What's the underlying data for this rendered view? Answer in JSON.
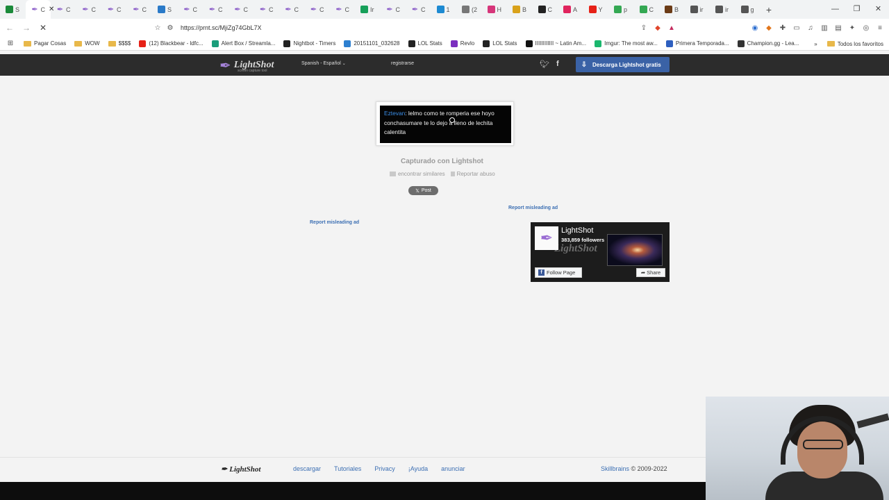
{
  "browser": {
    "tabs": [
      {
        "label": "S",
        "icon": "k-icon",
        "color": "#1b8a3a"
      },
      {
        "label": "C",
        "icon": "lightshot-feather-icon",
        "active": true
      },
      {
        "label": "C",
        "icon": "lightshot-feather-icon"
      },
      {
        "label": "C",
        "icon": "lightshot-feather-icon"
      },
      {
        "label": "C",
        "icon": "lightshot-feather-icon"
      },
      {
        "label": "C",
        "icon": "lightshot-feather-icon"
      },
      {
        "label": "S",
        "icon": "chart-icon",
        "color": "#2a7ac8"
      },
      {
        "label": "C",
        "icon": "lightshot-feather-icon"
      },
      {
        "label": "C",
        "icon": "lightshot-feather-icon"
      },
      {
        "label": "C",
        "icon": "lightshot-feather-icon"
      },
      {
        "label": "C",
        "icon": "lightshot-feather-icon"
      },
      {
        "label": "C",
        "icon": "lightshot-feather-icon"
      },
      {
        "label": "C",
        "icon": "lightshot-feather-icon"
      },
      {
        "label": "C",
        "icon": "lightshot-feather-icon"
      },
      {
        "label": "Ir",
        "icon": "green-icon",
        "color": "#17a05a"
      },
      {
        "label": "C",
        "icon": "lightshot-feather-icon"
      },
      {
        "label": "C",
        "icon": "lightshot-feather-icon"
      },
      {
        "label": "1",
        "icon": "blue-square-icon",
        "color": "#1d8ad2"
      },
      {
        "label": "(2",
        "icon": "gray-icon",
        "color": "#777777"
      },
      {
        "label": "H",
        "icon": "instagram-icon",
        "color": "#d6367a"
      },
      {
        "label": "B",
        "icon": "yellow-icon",
        "color": "#d9a21b"
      },
      {
        "label": "C",
        "icon": "github-icon",
        "color": "#222222"
      },
      {
        "label": "A",
        "icon": "pink-icon",
        "color": "#e0245e"
      },
      {
        "label": "Y",
        "icon": "youtube-icon",
        "color": "#e62117"
      },
      {
        "label": "p",
        "icon": "drive-icon",
        "color": "#34a853"
      },
      {
        "label": "C",
        "icon": "drive-icon",
        "color": "#34a853"
      },
      {
        "label": "B",
        "icon": "dark-icon",
        "color": "#6b3b16"
      },
      {
        "label": "ir",
        "icon": "globe-icon",
        "color": "#555555"
      },
      {
        "label": "ir",
        "icon": "globe-icon",
        "color": "#555555"
      },
      {
        "label": "g",
        "icon": "globe-icon",
        "color": "#555555"
      }
    ],
    "new_tab": "+",
    "url": "https://prnt.sc/MjiZg74GbL7X",
    "bookmarks": [
      {
        "label": "Pagar Cosas",
        "type": "folder"
      },
      {
        "label": "WOW",
        "type": "folder"
      },
      {
        "label": "$$$$",
        "type": "folder"
      },
      {
        "label": "(12) Blackbear - ldfc...",
        "color": "#e62117"
      },
      {
        "label": "Alert Box / Streamla...",
        "color": "#1a9d7a"
      },
      {
        "label": "Nightbot - Timers",
        "color": "#222222"
      },
      {
        "label": "20151101_032628",
        "color": "#2d7fd0"
      },
      {
        "label": "LOL Stats",
        "color": "#222222"
      },
      {
        "label": "Revlo",
        "color": "#7b2fbf"
      },
      {
        "label": "LOL Stats",
        "color": "#222222"
      },
      {
        "label": "IIIIIIIIIIII ~ Latin Am...",
        "color": "#111111"
      },
      {
        "label": "Imgur: The most aw...",
        "color": "#1bb76e"
      },
      {
        "label": "Primera Temporada...",
        "color": "#2e5fbf"
      },
      {
        "label": "Champion.gg - Lea...",
        "color": "#333333"
      }
    ],
    "bookmarks_more": "»",
    "all_bookmarks": "Todos los favoritos"
  },
  "site": {
    "logo_text": "LightShot",
    "logo_sub": "screen capture tool",
    "language": "Spanish - Español",
    "register": "registrarse",
    "download_btn": "Descarga Lightshot gratis",
    "screenshot": {
      "username": "Eztevan",
      "message": ": lelmo como te romperia ese hoyo conchasumare te lo dejo a lleno de lechita calentita"
    },
    "captured": "Capturado con Lightshot",
    "find_similar": "encontrar similares",
    "report_abuse": "Reportar abuso",
    "post_btn": "Post",
    "report_ad_1": "Report misleading ad",
    "report_ad_2": "Report misleading ad",
    "fb": {
      "name": "LightShot",
      "followers": "383,859 followers",
      "follow": "Follow Page",
      "share": "Share",
      "bg_text": "LightShot"
    },
    "footer": {
      "logo": "LightShot",
      "links": [
        "descargar",
        "Tutoriales",
        "Privacy",
        "¡Ayuda",
        "anunciar"
      ],
      "company": "Skillbrains",
      "copyright": " © 2009-2022"
    }
  }
}
